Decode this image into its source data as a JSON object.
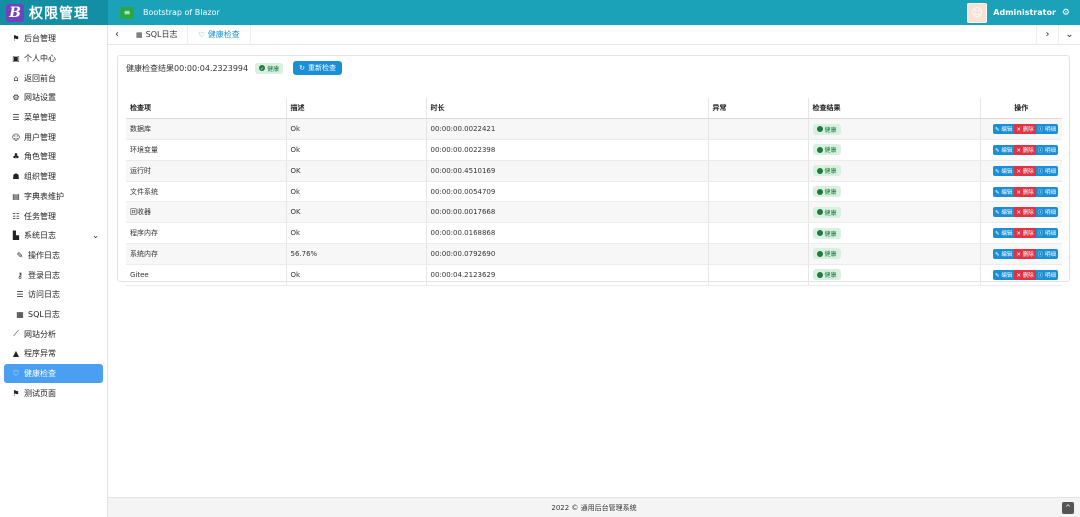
{
  "header": {
    "brand_logo": "B",
    "brand": "权限管理",
    "menu_icon": "≡",
    "title": "Bootstrap of Blazor",
    "user": "Administrator",
    "avatar_icon": "☺",
    "gear_icon": "⚙"
  },
  "sidebar": {
    "items": [
      {
        "icon": "⚑",
        "label": "后台管理",
        "name": "sidebar-item-admin"
      },
      {
        "icon": "▣",
        "label": "个人中心",
        "name": "sidebar-item-profile"
      },
      {
        "icon": "⌂",
        "label": "返回前台",
        "name": "sidebar-item-front"
      },
      {
        "icon": "⚙",
        "label": "网站设置",
        "name": "sidebar-item-site-settings"
      },
      {
        "icon": "☰",
        "label": "菜单管理",
        "name": "sidebar-item-menu"
      },
      {
        "icon": "☺",
        "label": "用户管理",
        "name": "sidebar-item-users"
      },
      {
        "icon": "♣",
        "label": "角色管理",
        "name": "sidebar-item-roles"
      },
      {
        "icon": "☗",
        "label": "组织管理",
        "name": "sidebar-item-org"
      },
      {
        "icon": "▤",
        "label": "字典表维护",
        "name": "sidebar-item-dict"
      },
      {
        "icon": "☷",
        "label": "任务管理",
        "name": "sidebar-item-tasks"
      },
      {
        "icon": "▙",
        "label": "系统日志",
        "name": "sidebar-item-syslog",
        "caret": "⌄"
      },
      {
        "icon": "✎",
        "label": "操作日志",
        "name": "sidebar-item-oplog",
        "sub": true
      },
      {
        "icon": "⚷",
        "label": "登录日志",
        "name": "sidebar-item-loginlog",
        "sub": true
      },
      {
        "icon": "☰",
        "label": "访问日志",
        "name": "sidebar-item-accesslog",
        "sub": true
      },
      {
        "icon": "▦",
        "label": "SQL日志",
        "name": "sidebar-item-sqllog",
        "sub": true
      },
      {
        "icon": "⟋",
        "label": "网站分析",
        "name": "sidebar-item-analytics"
      },
      {
        "icon": "▲",
        "label": "程序异常",
        "name": "sidebar-item-exceptions"
      },
      {
        "icon": "♡",
        "label": "健康检查",
        "name": "sidebar-item-health",
        "active": true
      },
      {
        "icon": "⚑",
        "label": "测试页面",
        "name": "sidebar-item-test"
      }
    ]
  },
  "tabs": {
    "prev": "‹",
    "next": "›",
    "more": "⌄",
    "items": [
      {
        "icon": "▦",
        "label": "SQL日志"
      },
      {
        "icon": "♡",
        "label": "健康检查",
        "active": true
      }
    ]
  },
  "summary": {
    "text": "健康检查结果00:00:04.2323994",
    "badge_icon": "✔",
    "badge": "健康",
    "recheck_icon": "↻",
    "recheck": "重新检查"
  },
  "table": {
    "headers": [
      "检查项",
      "描述",
      "时长",
      "异常",
      "检查结果",
      "操作"
    ],
    "status_label": "健康",
    "op_edit": "✎ 编辑",
    "op_delete": "✕ 删除",
    "op_detail": "ⓘ 明细",
    "rows": [
      {
        "item": "数据库",
        "desc": "Ok",
        "duration": "00:00:00.0022421",
        "error": ""
      },
      {
        "item": "环境变量",
        "desc": "Ok",
        "duration": "00:00:00.0022398",
        "error": ""
      },
      {
        "item": "运行时",
        "desc": "OK",
        "duration": "00:00:00.4510169",
        "error": ""
      },
      {
        "item": "文件系统",
        "desc": "Ok",
        "duration": "00:00:00.0054709",
        "error": ""
      },
      {
        "item": "回收器",
        "desc": "OK",
        "duration": "00:00:00.0017668",
        "error": ""
      },
      {
        "item": "程序内存",
        "desc": "Ok",
        "duration": "00:00:00.0168868",
        "error": ""
      },
      {
        "item": "系统内存",
        "desc": "56.76%",
        "duration": "00:00:00.0792690",
        "error": ""
      },
      {
        "item": "Gitee",
        "desc": "Ok",
        "duration": "00:00:04.2123629",
        "error": ""
      }
    ]
  },
  "footer": {
    "text": "2022 © 通用后台管理系统",
    "up_icon": "^"
  }
}
